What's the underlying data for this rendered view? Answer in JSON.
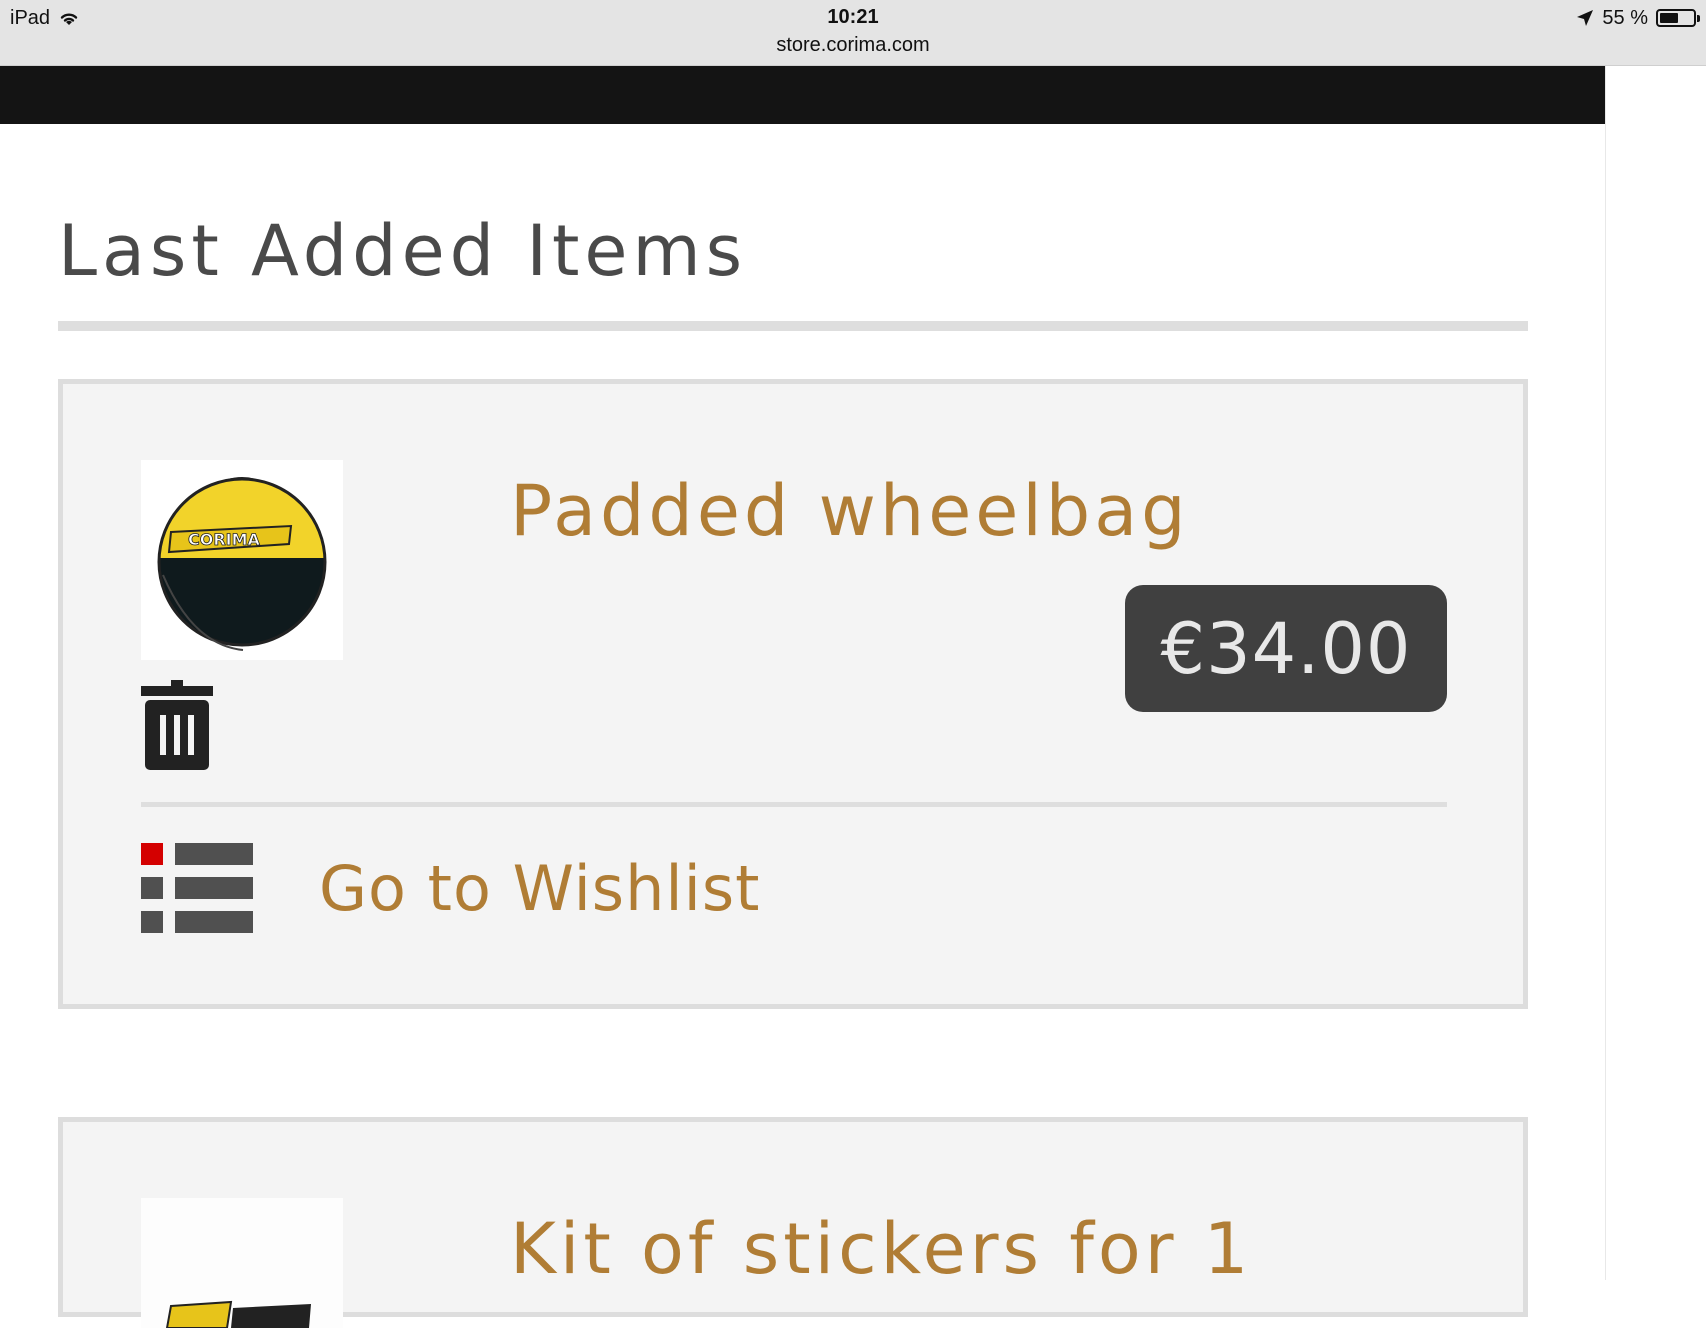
{
  "status_bar": {
    "device": "iPad",
    "time": "10:21",
    "url": "store.corima.com",
    "battery_percent": "55 %",
    "battery_level": 0.55,
    "icons": [
      "wifi-icon",
      "location-arrow-icon",
      "battery-icon"
    ]
  },
  "page": {
    "section_title": "Last Added Items"
  },
  "items": [
    {
      "name": "Padded wheelbag",
      "price": "€34.00",
      "thumbnail_icon": "wheelbag-image",
      "thumbnail_logo_text": "CORIMA",
      "wishlist_link": "Go to Wishlist"
    },
    {
      "name": "Kit of stickers for 1",
      "thumbnail_icon": "sticker-kit-image"
    }
  ],
  "colors": {
    "accent_gold": "#b07d35",
    "price_badge_bg": "#404040",
    "header_bar": "#141414",
    "wishlist_icon_red": "#d40000",
    "wishlist_icon_gray": "#505050",
    "bag_yellow": "#f2d32a"
  }
}
